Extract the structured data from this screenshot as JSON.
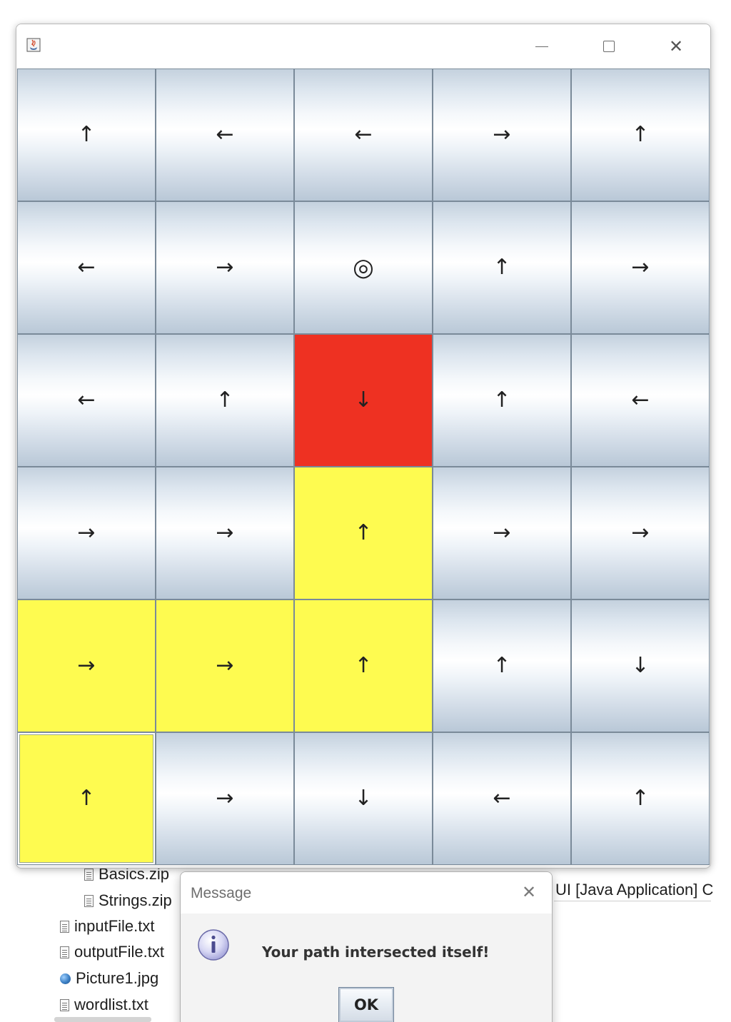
{
  "frame": {
    "title": "",
    "icon": "java-cup-icon",
    "controls": {
      "minimize_icon": "minimize-icon",
      "maximize_icon": "maximize-icon",
      "close_glyph": "✕"
    }
  },
  "grid": {
    "rows": 6,
    "cols": 5,
    "cells": [
      [
        {
          "glyph": "↑",
          "state": "default"
        },
        {
          "glyph": "←",
          "state": "default"
        },
        {
          "glyph": "←",
          "state": "default"
        },
        {
          "glyph": "→",
          "state": "default"
        },
        {
          "glyph": "↑",
          "state": "default"
        }
      ],
      [
        {
          "glyph": "←",
          "state": "default"
        },
        {
          "glyph": "→",
          "state": "default"
        },
        {
          "glyph": "◎",
          "state": "default"
        },
        {
          "glyph": "↑",
          "state": "default"
        },
        {
          "glyph": "→",
          "state": "default"
        }
      ],
      [
        {
          "glyph": "←",
          "state": "default"
        },
        {
          "glyph": "↑",
          "state": "default"
        },
        {
          "glyph": "↓",
          "state": "red"
        },
        {
          "glyph": "↑",
          "state": "default"
        },
        {
          "glyph": "←",
          "state": "default"
        }
      ],
      [
        {
          "glyph": "→",
          "state": "default"
        },
        {
          "glyph": "→",
          "state": "default"
        },
        {
          "glyph": "↑",
          "state": "yellow"
        },
        {
          "glyph": "→",
          "state": "default"
        },
        {
          "glyph": "→",
          "state": "default"
        }
      ],
      [
        {
          "glyph": "→",
          "state": "yellow"
        },
        {
          "glyph": "→",
          "state": "yellow"
        },
        {
          "glyph": "↑",
          "state": "yellow"
        },
        {
          "glyph": "↑",
          "state": "default"
        },
        {
          "glyph": "↓",
          "state": "default"
        }
      ],
      [
        {
          "glyph": "↑",
          "state": "yellow",
          "focused": true
        },
        {
          "glyph": "→",
          "state": "default"
        },
        {
          "glyph": "↓",
          "state": "default"
        },
        {
          "glyph": "←",
          "state": "default"
        },
        {
          "glyph": "↑",
          "state": "default"
        }
      ]
    ],
    "colors": {
      "path": "#fefb50",
      "intersection": "#ee3122"
    }
  },
  "ide": {
    "tree_items": [
      {
        "label": "Basics.zip",
        "icon": "text-file-icon"
      },
      {
        "label": "Strings.zip",
        "icon": "text-file-icon"
      },
      {
        "label": "inputFile.txt",
        "icon": "text-file-icon"
      },
      {
        "label": "outputFile.txt",
        "icon": "text-file-icon"
      },
      {
        "label": "Picture1.jpg",
        "icon": "image-file-icon"
      },
      {
        "label": "wordlist.txt",
        "icon": "text-file-icon"
      }
    ],
    "console_title": "UI [Java Application] C"
  },
  "dialog": {
    "title": "Message",
    "close_glyph": "✕",
    "icon": "info-icon",
    "message": "Your path intersected itself!",
    "ok_label": "OK"
  }
}
